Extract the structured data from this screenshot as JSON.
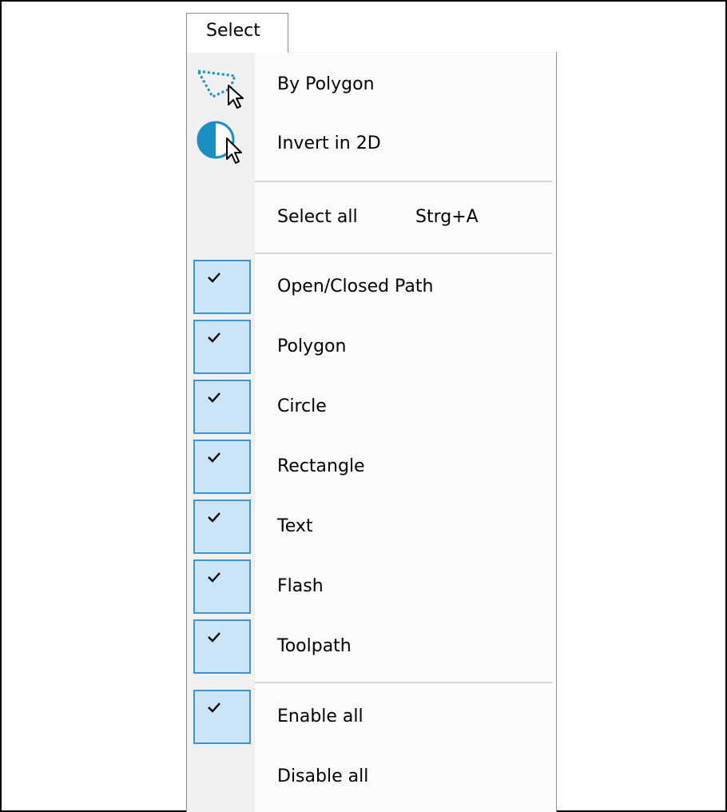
{
  "menu": {
    "title": "Select",
    "actions": [
      {
        "label": "By Polygon",
        "icon": "polygon-select-icon"
      },
      {
        "label": "Invert in 2D",
        "icon": "invert-select-icon"
      }
    ],
    "select_all": {
      "label": "Select all",
      "shortcut": "Strg+A"
    },
    "filters": [
      {
        "label": "Open/Closed Path",
        "checked": true
      },
      {
        "label": "Polygon",
        "checked": true
      },
      {
        "label": "Circle",
        "checked": true
      },
      {
        "label": "Rectangle",
        "checked": true
      },
      {
        "label": "Text",
        "checked": true
      },
      {
        "label": "Flash",
        "checked": true
      },
      {
        "label": "Toolpath",
        "checked": true
      }
    ],
    "enable_all": {
      "label": "Enable all",
      "checked": true
    },
    "disable_all": {
      "label": "Disable all"
    }
  },
  "colors": {
    "check_fill": "#cce4f7",
    "check_border": "#3c93d8",
    "icon_accent": "#1a8fc4"
  }
}
